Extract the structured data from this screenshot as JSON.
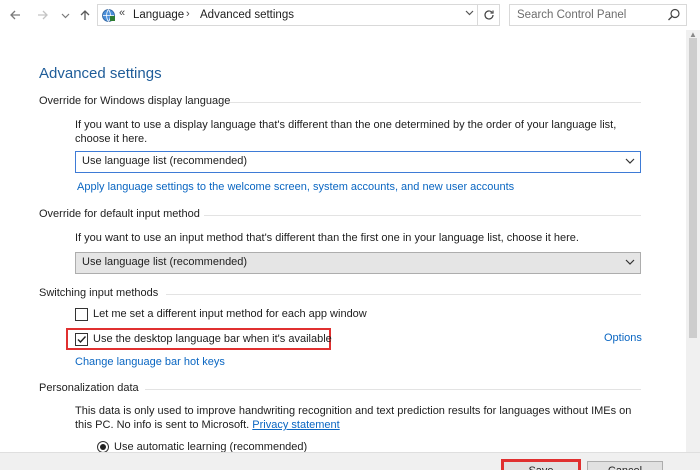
{
  "address_bar": {
    "back_icon": "back-arrow-icon",
    "forward_icon": "forward-arrow-icon",
    "recent_icon": "chevron-down-icon",
    "up_icon": "up-arrow-icon",
    "overflow": "«",
    "crumbs": [
      "Language",
      "Advanced settings"
    ],
    "separator": "›",
    "search_placeholder": "Search Control Panel"
  },
  "page": {
    "title": "Advanced settings"
  },
  "display_language": {
    "heading": "Override for Windows display language",
    "description": "If you want to use a display language that's different than the one determined by the order of your language list, choose it here.",
    "selected": "Use language list (recommended)",
    "link": "Apply language settings to the welcome screen, system accounts, and new user accounts"
  },
  "input_method": {
    "heading": "Override for default input method",
    "description": "If you want to use an input method that's different than the first one in your language list, choose it here.",
    "selected": "Use language list (recommended)"
  },
  "switching": {
    "heading": "Switching input methods",
    "per_app_label": "Let me set a different input method for each app window",
    "per_app_checked": false,
    "language_bar_label": "Use the desktop language bar when it's available",
    "language_bar_checked": true,
    "options_link": "Options",
    "hotkeys_link": "Change language bar hot keys"
  },
  "personalization": {
    "heading": "Personalization data",
    "description_1": "This data is only used to improve handwriting recognition and text prediction results for languages without IMEs on this PC. No info is sent to Microsoft.",
    "privacy_link": "Privacy statement",
    "radio_label": "Use automatic learning (recommended)"
  },
  "footer": {
    "save_label": "Save",
    "cancel_label": "Cancel"
  },
  "colors": {
    "accent": "#1f5d99",
    "link": "#0a66c2",
    "highlight": "#e03030"
  }
}
